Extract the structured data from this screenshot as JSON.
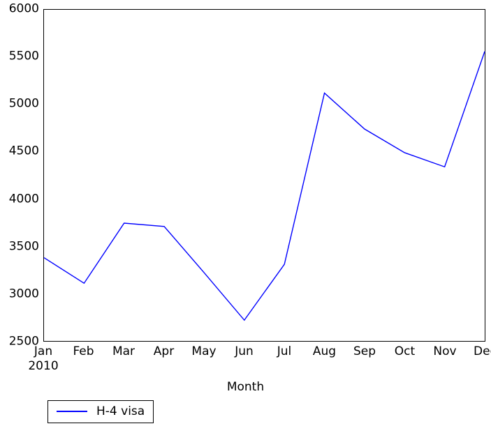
{
  "chart_data": {
    "type": "line",
    "title": "",
    "xlabel": "Month",
    "ylabel": "",
    "x_year_label": "2010",
    "categories": [
      "Jan",
      "Feb",
      "Mar",
      "Apr",
      "May",
      "Jun",
      "Jul",
      "Aug",
      "Sep",
      "Oct",
      "Nov",
      "Dec"
    ],
    "xtick_labels": [
      "Jan",
      "Feb",
      "Mar",
      "Apr",
      "May",
      "Jun",
      "Jul",
      "Aug",
      "Sep",
      "Oct",
      "Nov",
      "Dec"
    ],
    "ytick_labels": [
      "2500",
      "3000",
      "3500",
      "4000",
      "4500",
      "5000",
      "5500",
      "6000"
    ],
    "yticks": [
      2500,
      3000,
      3500,
      4000,
      4500,
      5000,
      5500,
      6000
    ],
    "ylim": [
      2500,
      6000
    ],
    "grid": false,
    "legend_position": "below-left",
    "series": [
      {
        "name": "H-4 visa",
        "color": "#0000ff",
        "values": [
          3380,
          3110,
          3745,
          3710,
          3220,
          2720,
          3310,
          5120,
          4740,
          4490,
          4340,
          5560
        ]
      }
    ]
  },
  "legend": {
    "entries": [
      {
        "label": "H-4 visa",
        "swatch": "line-swatch-blue"
      }
    ]
  }
}
